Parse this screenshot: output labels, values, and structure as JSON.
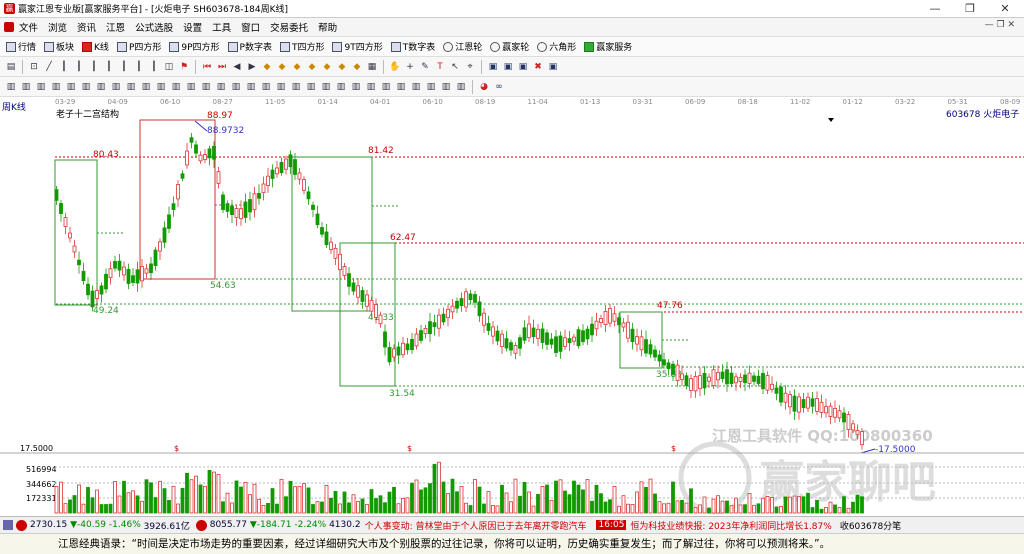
{
  "window": {
    "title": "赢家江恩专业版[赢家服务平台] - [火炬电子  SH603678-184周K线]",
    "controls": [
      "—",
      "❐",
      "✕"
    ]
  },
  "menu": [
    "文件",
    "浏览",
    "资讯",
    "江恩",
    "公式选股",
    "设置",
    "工具",
    "窗口",
    "交易委托",
    "帮助"
  ],
  "toolbar": [
    {
      "icon": "table-icon",
      "label": "行情"
    },
    {
      "icon": "blocks-icon",
      "label": "板块"
    },
    {
      "icon": "kline-icon",
      "label": "K线"
    },
    {
      "icon": "p-square-icon",
      "label": "P四方形"
    },
    {
      "icon": "9p-square-icon",
      "label": "9P四方形"
    },
    {
      "icon": "p-number-icon",
      "label": "P数字表"
    },
    {
      "icon": "t-square-icon",
      "label": "T四方形"
    },
    {
      "icon": "9t-square-icon",
      "label": "9T四方形"
    },
    {
      "icon": "t-number-icon",
      "label": "T数字表"
    },
    {
      "icon": "gann-wheel-icon",
      "label": "江恩轮"
    },
    {
      "icon": "winner-wheel-icon",
      "label": "赢家轮"
    },
    {
      "icon": "hexagon-icon",
      "label": "六角形"
    },
    {
      "icon": "service-icon",
      "label": "赢家服务"
    }
  ],
  "chart": {
    "period_label": "周K线",
    "indicator_label": "老子十二宫结构",
    "stock_label": "603678  火炬电子",
    "date_ticks": [
      "03-29",
      "04-09",
      "06-10",
      "08-27",
      "11-05",
      "01-14",
      "04-01",
      "06-10",
      "08-19",
      "11-04",
      "01-13",
      "03-31",
      "06-09",
      "08-18",
      "11-02",
      "01-12",
      "03-22",
      "05-31",
      "08-09"
    ],
    "price_labels": [
      "88.97",
      "88.9732",
      "80.43",
      "81.42",
      "62.47",
      "54.63",
      "49.24",
      "47.76",
      "41.33",
      "35.83",
      "31.54",
      "-17.5000"
    ],
    "volume_axis": [
      "17.5000",
      "516994",
      "344662",
      "172331"
    ],
    "dollar_marker": "$",
    "watermark_line1": "江恩工具软件  QQ:100800360",
    "watermark_line2": "赢家聊吧"
  },
  "chart_data": {
    "type": "candlestick",
    "title": "老子十二宫结构",
    "series_name": "603678 火炬电子",
    "period": "周K线",
    "annotated_levels": [
      88.97,
      88.9732,
      81.42,
      80.43,
      62.47,
      54.63,
      49.24,
      47.76,
      41.33,
      35.83,
      31.54,
      17.5
    ],
    "latest_low": 17.5,
    "volume_ticks": [
      516994,
      344662,
      172331
    ],
    "ylim": [
      17.5,
      90
    ]
  },
  "status": {
    "sh_index": "2730.15",
    "sh_change": "▼-40.59",
    "sh_pct": "-1.46%",
    "sh_amount": "3926.61亿",
    "sz_index": "8055.77",
    "sz_change": "▼-184.71",
    "sz_pct": "-2.24%",
    "sz_amount": "4130.2",
    "news1": "个人事变动: 曾林堂由于个人原因已于去年离开零跑汽车",
    "news_time": "16:05",
    "news2": "恒为科技业绩快报: 2023年净利润同比增长1.87%",
    "right_text": "收603678分笔"
  },
  "quote": "江恩经典语录：“时间是决定市场走势的重要因素，经过详细研究大市及个别股票的过往记录，你将可以证明，历史确实重复发生；而了解过往，你将可以预测将来。”。"
}
